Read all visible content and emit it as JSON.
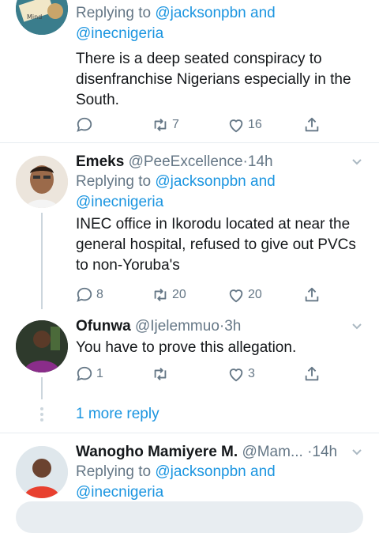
{
  "tweets": [
    {
      "reply_prefix": "Replying to",
      "reply_to": "@jacksonpbn and",
      "reply_to2": "@inecnigeria",
      "text": "There is a deep seated conspiracy to disenfranchise Nigerians especially in the South.",
      "actions": {
        "reply": "",
        "retweet": "7",
        "like": "16"
      }
    },
    {
      "name": "Emeks",
      "handle": "@PeeExcellence",
      "sep": "·",
      "time": "14h",
      "reply_prefix": "Replying to",
      "reply_to": "@jacksonpbn and",
      "reply_to2": "@inecnigeria",
      "text": "INEC office in Ikorodu located at near the general hospital, refused to give out PVCs to non-Yoruba's",
      "actions": {
        "reply": "8",
        "retweet": "20",
        "like": "20"
      }
    },
    {
      "name": "Ofunwa",
      "handle": "@Ijelemmuo",
      "sep": "·",
      "time": "3h",
      "text": "You have to prove this allegation.",
      "actions": {
        "reply": "1",
        "retweet": "",
        "like": "3"
      }
    },
    {
      "name": "Wanogho Mamiyere M.",
      "handle": "@Mam...",
      "sep": "·",
      "time": "14h",
      "reply_prefix": "Replying to",
      "reply_to": "@jacksonpbn and",
      "reply_to2": "@inecnigeria"
    }
  ],
  "more_replies": "1 more reply",
  "colors": {
    "link": "#1b95e0",
    "muted": "#657786",
    "text": "#14171a",
    "divider": "#e6ecf0"
  }
}
